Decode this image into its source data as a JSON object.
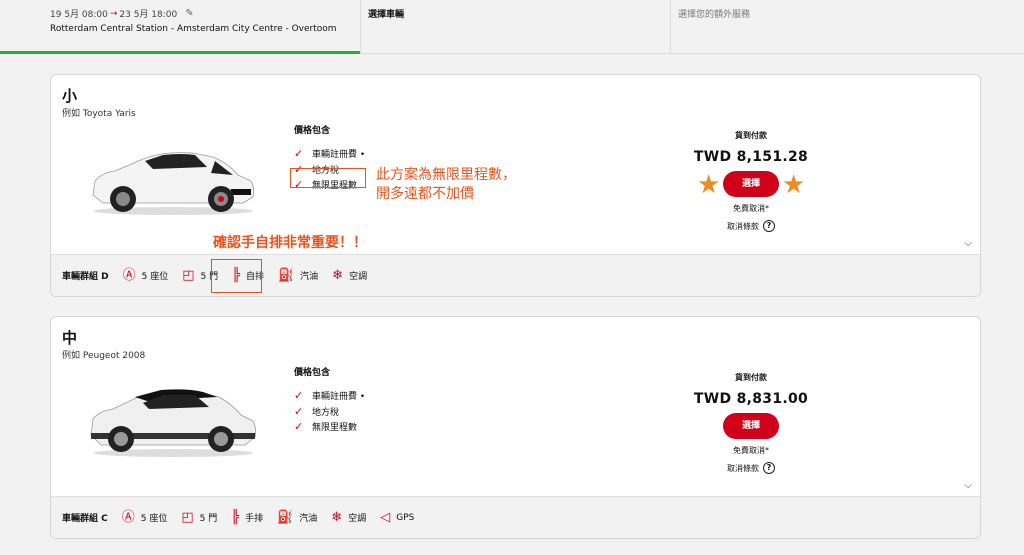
{
  "header": {
    "trip": {
      "date_from": "19 5月 08:00",
      "arrow": "→",
      "date_to": "23 5月 18:00",
      "route": "Rotterdam Central Station - Amsterdam City Centre - Overtoom",
      "edit_icon": "pencil-icon"
    },
    "step2_title": "選擇車輛",
    "step3_title": "選擇您的額外服務"
  },
  "cards": [
    {
      "category": "小",
      "example": "例如 Toyota Yaris",
      "includes_heading": "價格包含",
      "includes": [
        "車輛註冊費 •",
        "地方稅",
        "無限里程數"
      ],
      "pay_label": "貨到付款",
      "price": "TWD 8,151.28",
      "select_label": "選擇",
      "free_cancel": "免費取消*",
      "cancel_terms": "取消條款",
      "group_label": "車輛群組 D",
      "features": [
        {
          "icon": "seat-icon",
          "label": "5 座位"
        },
        {
          "icon": "door-icon",
          "label": "5 門"
        },
        {
          "icon": "gearbox-icon",
          "label": "自排"
        },
        {
          "icon": "fuel-icon",
          "label": "汽油"
        },
        {
          "icon": "snowflake-icon",
          "label": "空調"
        }
      ]
    },
    {
      "category": "中",
      "example": "例如 Peugeot 2008",
      "includes_heading": "價格包含",
      "includes": [
        "車輛註冊費 •",
        "地方稅",
        "無限里程數"
      ],
      "pay_label": "貨到付款",
      "price": "TWD 8,831.00",
      "select_label": "選擇",
      "free_cancel": "免費取消*",
      "cancel_terms": "取消條款",
      "group_label": "車輛群組 C",
      "features": [
        {
          "icon": "seat-icon",
          "label": "5 座位"
        },
        {
          "icon": "door-icon",
          "label": "5 門"
        },
        {
          "icon": "gearbox-icon",
          "label": "手排"
        },
        {
          "icon": "fuel-icon",
          "label": "汽油"
        },
        {
          "icon": "snowflake-icon",
          "label": "空調"
        },
        {
          "icon": "navigation-icon",
          "label": "GPS"
        }
      ]
    }
  ],
  "annotations": {
    "mileage_note_line1": "此方案為無限里程數，",
    "mileage_note_line2": "開多遠都不加價",
    "transmission_note": "確認手自排非常重要！！"
  },
  "colors": {
    "accent_red": "#d0021b",
    "progress_green": "#2eaa33",
    "annotation_orange": "#e8541e",
    "star_orange": "#f08a24"
  }
}
